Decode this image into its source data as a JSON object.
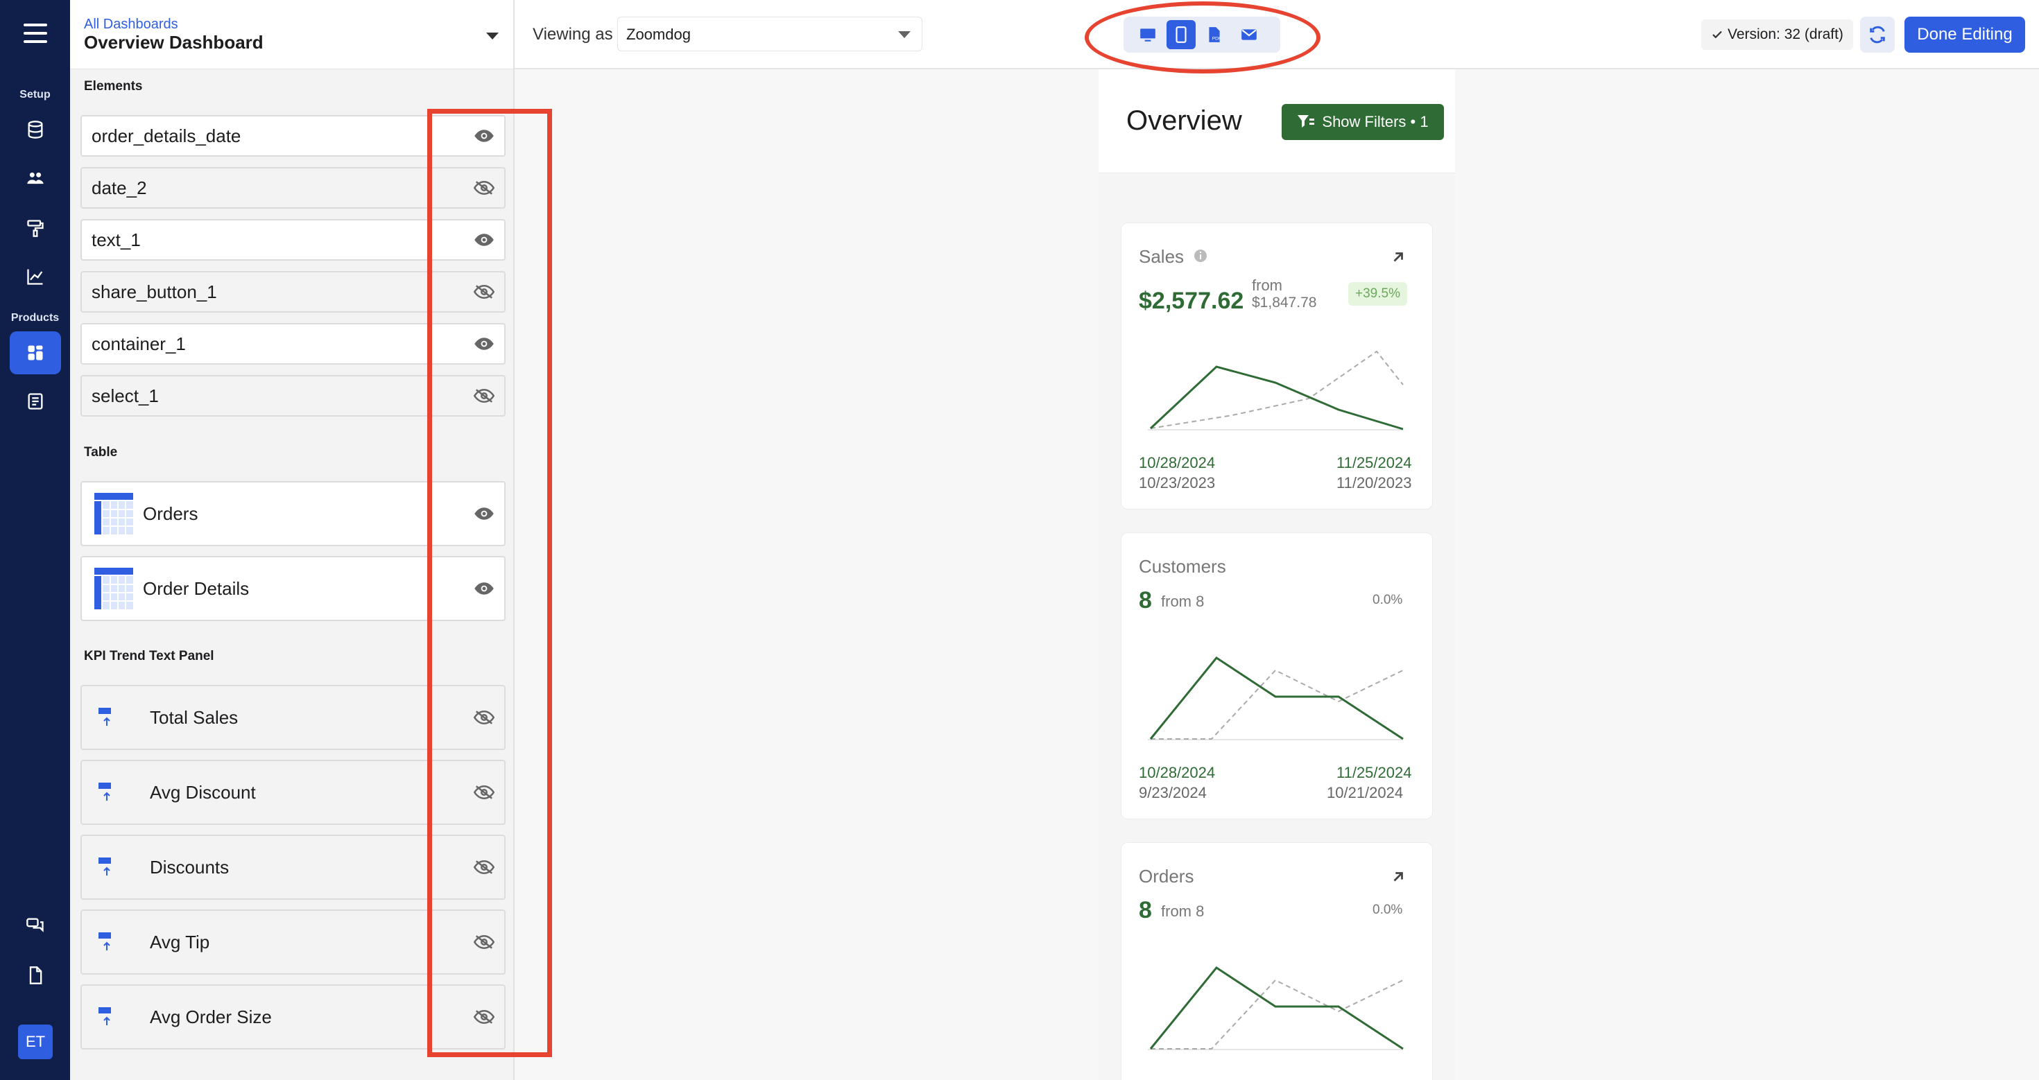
{
  "rail": {
    "setup_label": "Setup",
    "products_label": "Products",
    "avatar": "ET"
  },
  "sidebar": {
    "breadcrumb": "All Dashboards",
    "title": "Overview Dashboard",
    "sections": {
      "elements": "Elements",
      "table": "Table",
      "kpi": "KPI Trend Text Panel"
    },
    "elements": [
      {
        "label": "order_details_date",
        "visible": true
      },
      {
        "label": "date_2",
        "visible": false
      },
      {
        "label": "text_1",
        "visible": true
      },
      {
        "label": "share_button_1",
        "visible": false
      },
      {
        "label": "container_1",
        "visible": true
      },
      {
        "label": "select_1",
        "visible": false
      }
    ],
    "tables": [
      {
        "label": "Orders",
        "visible": true
      },
      {
        "label": "Order Details",
        "visible": true
      }
    ],
    "kpis": [
      {
        "label": "Total Sales",
        "visible": false
      },
      {
        "label": "Avg Discount",
        "visible": false
      },
      {
        "label": "Discounts",
        "visible": false
      },
      {
        "label": "Avg Tip",
        "visible": false
      },
      {
        "label": "Avg Order Size",
        "visible": false
      }
    ]
  },
  "topbar": {
    "viewing_label": "Viewing as",
    "viewing_value": "Zoomdog",
    "version": "Version: 32 (draft)",
    "done_label": "Done Editing",
    "devices": [
      "desktop-icon",
      "mobile-icon",
      "pdf-icon",
      "email-icon"
    ],
    "active_device": "mobile-icon"
  },
  "preview": {
    "title": "Overview",
    "filter_label": "Show Filters • 1",
    "cards": [
      {
        "title": "Sales",
        "value": "$2,577.62",
        "from_label": "from",
        "from_value": "$1,847.78",
        "change": "+39.5%",
        "date_start": "10/28/2024",
        "date_end": "11/25/2024",
        "prev_start": "10/23/2023",
        "prev_end": "11/20/2023"
      },
      {
        "title": "Customers",
        "value": "8",
        "from_label": "from 8",
        "change": "0.0%",
        "date_start": "10/28/2024",
        "date_end": "11/25/2024",
        "prev_start": "9/23/2024",
        "prev_end": "10/21/2024"
      },
      {
        "title": "Orders",
        "value": "8",
        "from_label": "from 8",
        "change": "0.0%"
      }
    ]
  },
  "colors": {
    "accent": "#2f5fe0",
    "nav": "#0f1f4a",
    "positive": "#2f6b35",
    "annotation": "#e64330"
  }
}
